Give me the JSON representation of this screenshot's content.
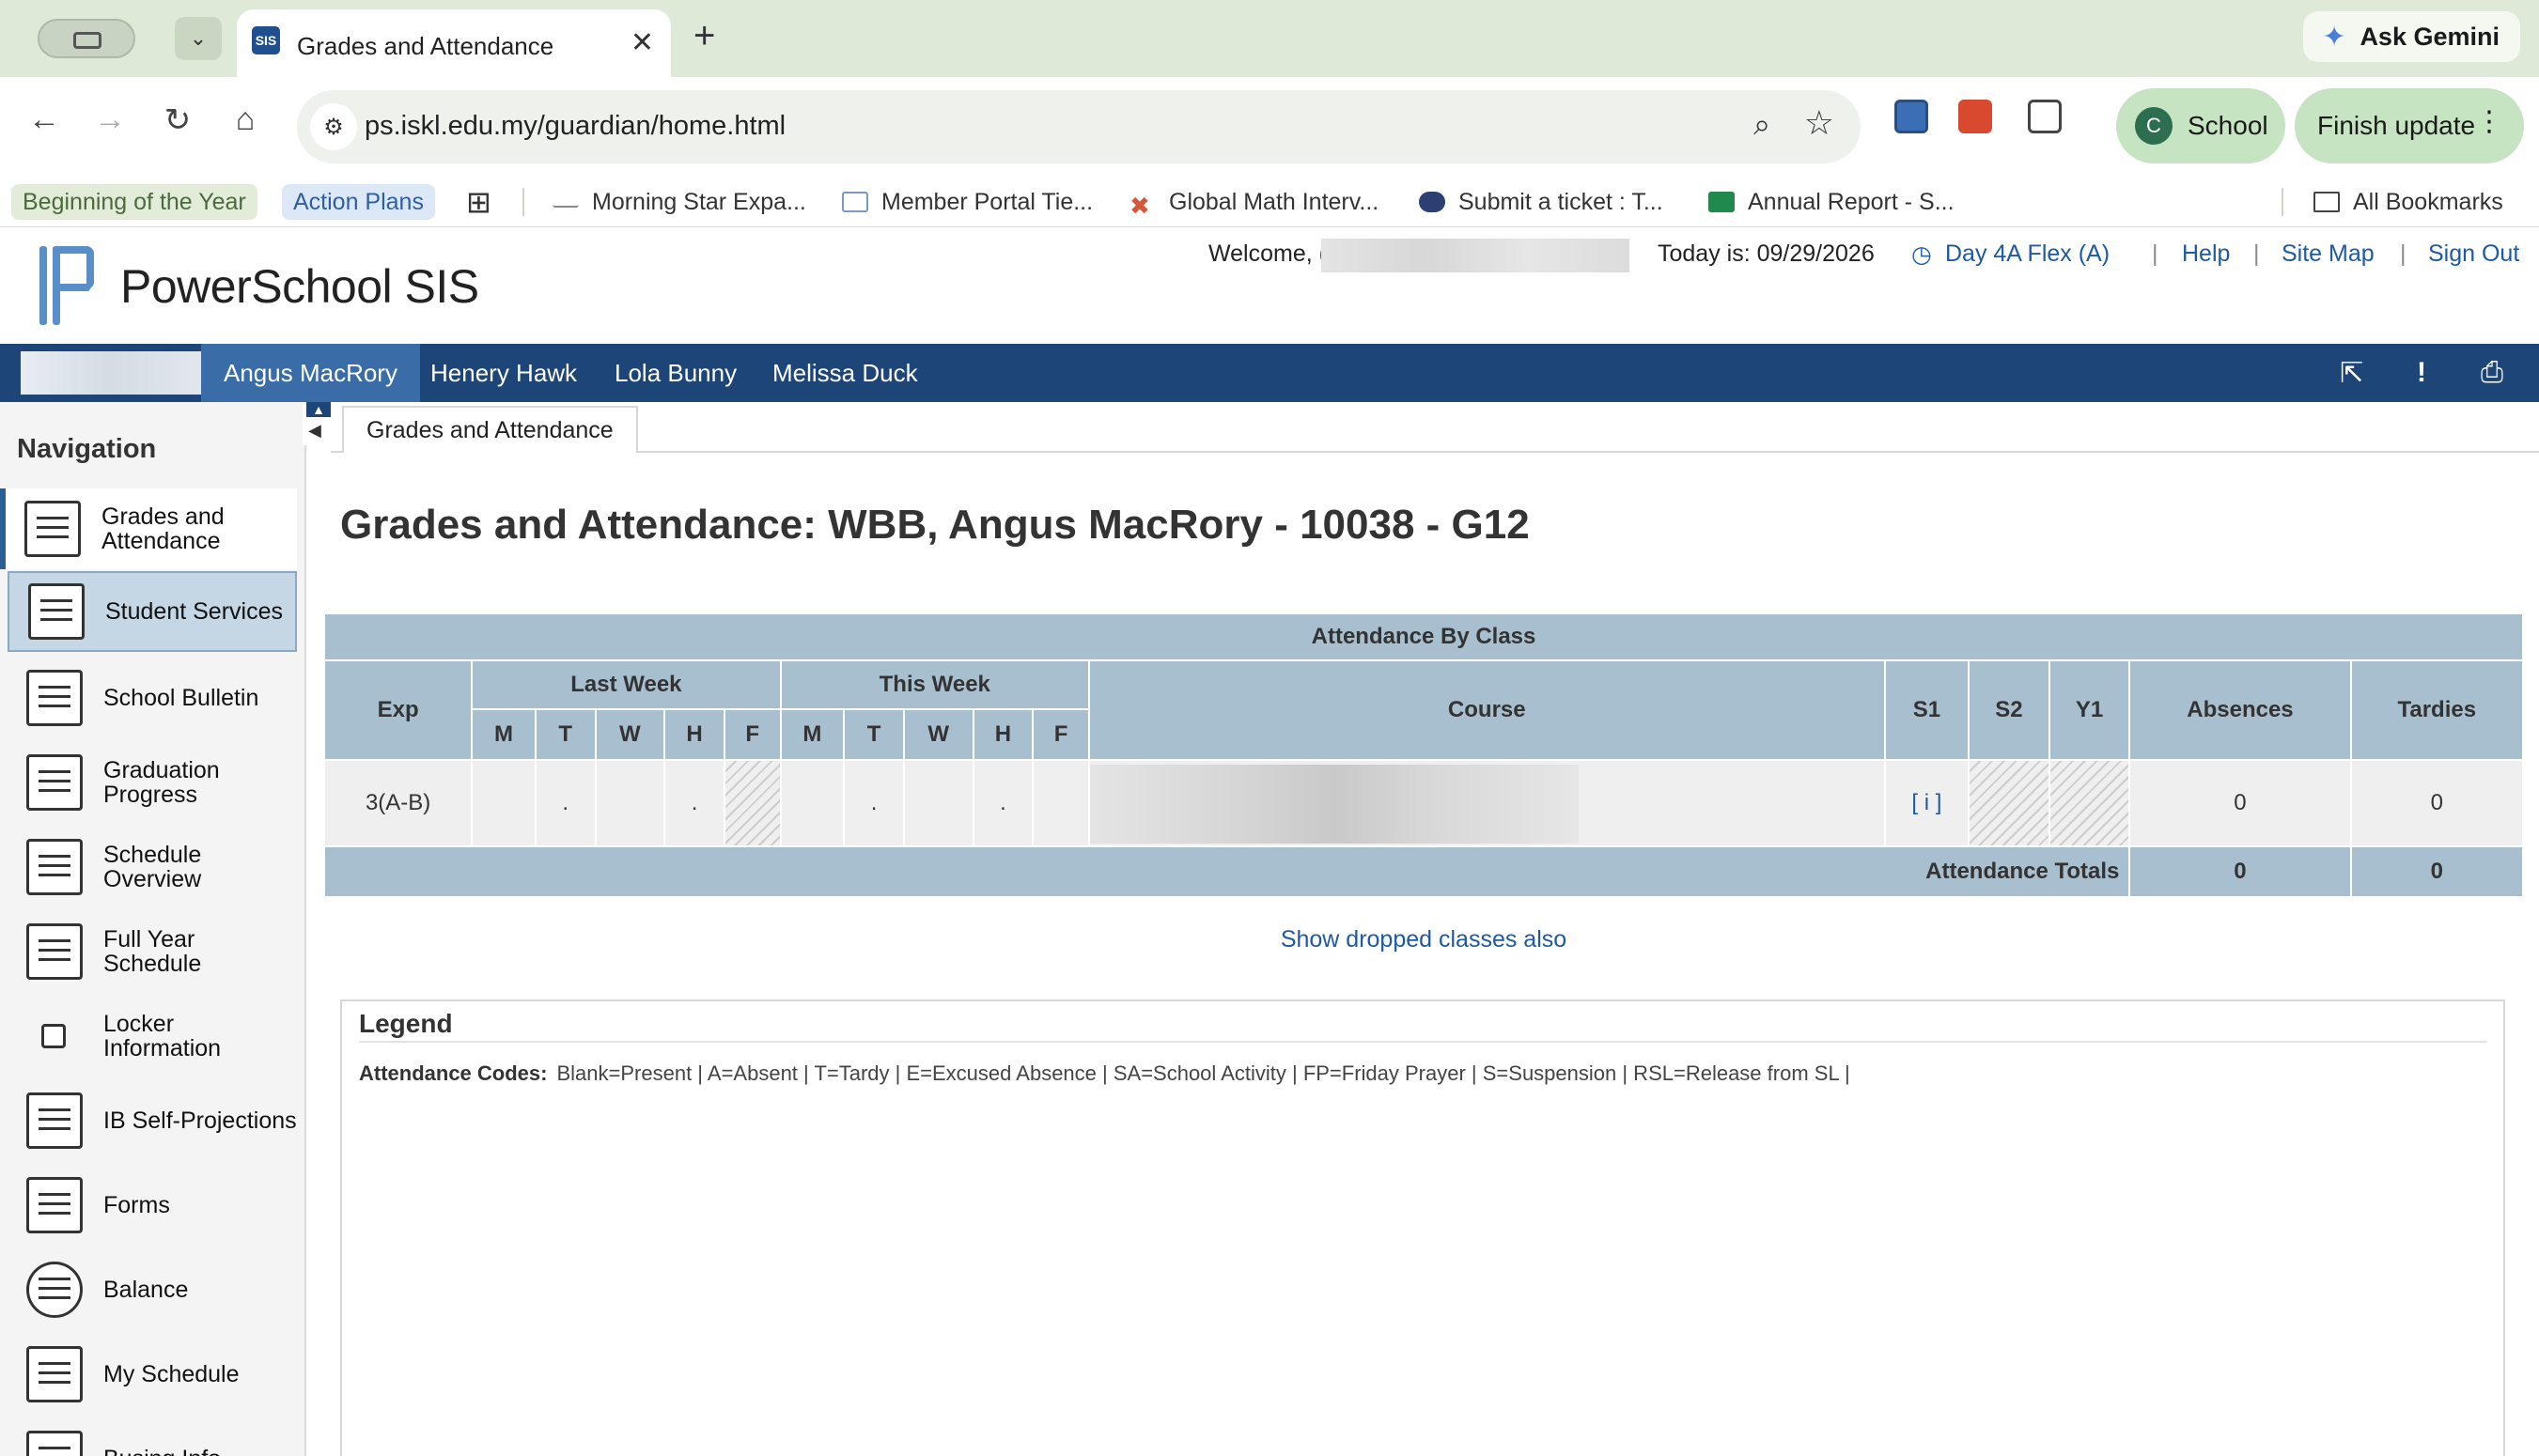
{
  "browser": {
    "tab_title": "Grades and Attendance",
    "tab_favicon": "SIS",
    "url": "ps.iskl.edu.my/guardian/home.html",
    "ask_gemini": "Ask Gemini",
    "profile_initial": "C",
    "profile_name": "School",
    "finish_update": "Finish update",
    "bookmarks": [
      {
        "label": "Beginning of the Year"
      },
      {
        "label": "Action Plans"
      },
      {
        "label": "Morning Star Expa..."
      },
      {
        "label": "Member Portal Tie..."
      },
      {
        "label": "Global Math Interv..."
      },
      {
        "label": "Submit a ticket : T..."
      },
      {
        "label": "Annual Report - S..."
      },
      {
        "label": "All Bookmarks"
      }
    ]
  },
  "header": {
    "brand": "PowerSchool SIS",
    "welcome": "Welcome, (",
    "today": "Today is: 09/29/2026",
    "day": "Day 4A Flex (A)",
    "links": {
      "help": "Help",
      "site_map": "Site Map",
      "sign_out": "Sign Out"
    },
    "separator": "|"
  },
  "students": [
    {
      "name": "Angus MacRory",
      "active": true
    },
    {
      "name": "Henery Hawk"
    },
    {
      "name": "Lola Bunny"
    },
    {
      "name": "Melissa Duck"
    }
  ],
  "sidebar": {
    "title": "Navigation",
    "items": [
      {
        "label": "Grades and Attendance",
        "icon": "grades-icon"
      },
      {
        "label": "Student Services",
        "icon": "document-list-icon"
      },
      {
        "label": "School Bulletin",
        "icon": "bulletin-icon"
      },
      {
        "label": "Graduation Progress",
        "icon": "school-building-icon"
      },
      {
        "label": "Schedule Overview",
        "icon": "calendar-clock-icon"
      },
      {
        "label": "Full Year Schedule",
        "icon": "calendar-clock-icon"
      },
      {
        "label": "Locker Information",
        "icon": "lock-icon"
      },
      {
        "label": "IB Self-Projections",
        "icon": "speech-bubble-icon"
      },
      {
        "label": "Forms",
        "icon": "checklist-icon"
      },
      {
        "label": "Balance",
        "icon": "coins-icon"
      },
      {
        "label": "My Schedule",
        "icon": "calendar-clock-icon"
      },
      {
        "label": "Busing Info",
        "icon": "bus-icon"
      }
    ]
  },
  "page": {
    "tab": "Grades and Attendance",
    "title": "Grades and Attendance: WBB, Angus MacRory - 10038 - G12"
  },
  "attendance": {
    "caption": "Attendance By Class",
    "headers": {
      "exp": "Exp",
      "last_week": "Last Week",
      "this_week": "This Week",
      "course": "Course",
      "s1": "S1",
      "s2": "S2",
      "y1": "Y1",
      "absences": "Absences",
      "tardies": "Tardies",
      "days": [
        "M",
        "T",
        "W",
        "H",
        "F"
      ]
    },
    "row": {
      "exp": "3(A-B)",
      "last_week": [
        "",
        ".",
        "",
        ".",
        ""
      ],
      "this_week": [
        "",
        ".",
        "",
        ".",
        ""
      ],
      "s1": "[ i ]",
      "absences": "0",
      "tardies": "0"
    },
    "totals": {
      "label": "Attendance Totals",
      "absences": "0",
      "tardies": "0"
    }
  },
  "show_dropped": "Show dropped classes also",
  "legend": {
    "title": "Legend",
    "codes_label": "Attendance Codes:",
    "codes": "Blank=Present | A=Absent | T=Tardy | E=Excused Absence | SA=School Activity | FP=Friday Prayer | S=Suspension | RSL=Release from SL |"
  },
  "colors": {
    "nav_bar": "#1d4577",
    "active_student": "#3a6ca8",
    "table_header": "#a8bfd0",
    "link": "#1d5aa3"
  }
}
